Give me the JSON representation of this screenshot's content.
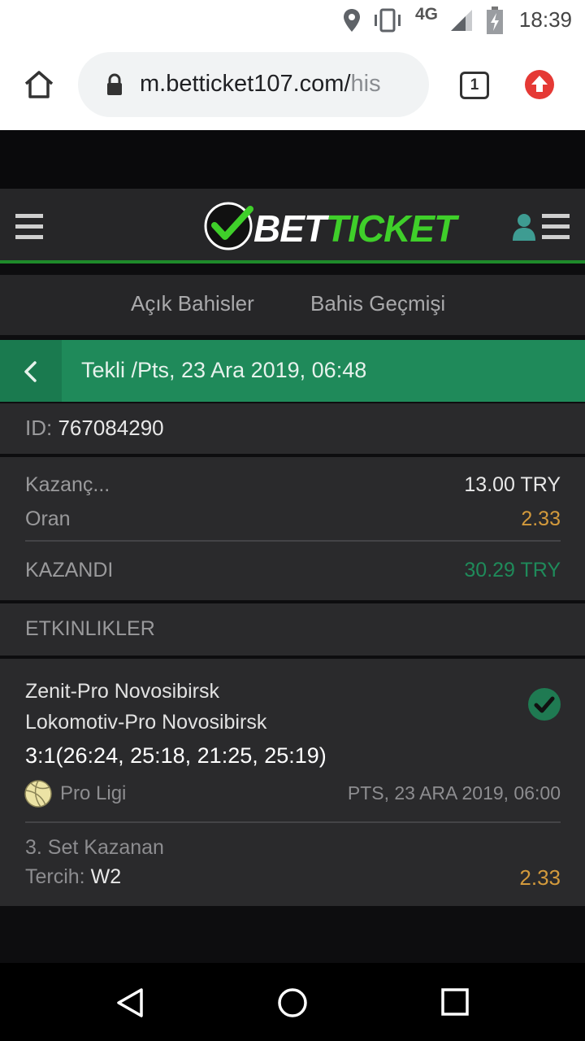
{
  "status": {
    "time": "18:39",
    "network": "4G"
  },
  "browser": {
    "url_main": "m.betticket107.com/",
    "url_dim": "his",
    "tab_count": "1"
  },
  "site": {
    "logo_bet": "BET",
    "logo_ticket": "TICKET"
  },
  "tabs": [
    {
      "label": "Açık Bahisler"
    },
    {
      "label": "Bahis Geçmişi"
    }
  ],
  "bet": {
    "header_title": "Tekli /Pts, 23 Ara 2019, 06:48",
    "id_label": "ID:",
    "id_value": "767084290",
    "stake_label": "Kazanç...",
    "stake_value": "13.00 TRY",
    "odds_label": "Oran",
    "odds_value": "2.33",
    "result_label": "KAZANDI",
    "result_value": "30.29 TRY"
  },
  "events": {
    "header": "ETKINLIKLER",
    "items": [
      {
        "team1": "Zenit-Pro Novosibirsk",
        "team2": "Lokomotiv-Pro Novosibirsk",
        "score": "3:1(26:24, 25:18, 21:25, 25:19)",
        "league": "Pro Ligi",
        "date": "PTS, 23 ARA 2019, 06:00",
        "market": "3. Set Kazanan",
        "pick_label": "Tercih:",
        "pick_value": "W2",
        "odds": "2.33"
      }
    ]
  },
  "colors": {
    "accent_green": "#1f8a5a",
    "logo_green": "#3fcf2a",
    "odds_orange": "#d39a3c",
    "win_teal": "#1f8a5a"
  }
}
